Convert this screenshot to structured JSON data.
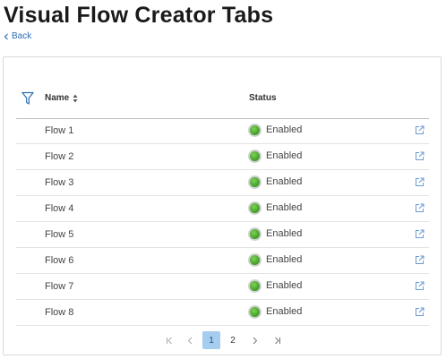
{
  "page": {
    "title": "Visual Flow Creator Tabs",
    "back_label": "Back"
  },
  "table": {
    "columns": {
      "name": "Name",
      "status": "Status"
    },
    "rows": [
      {
        "name": "Flow 1",
        "status": "Enabled"
      },
      {
        "name": "Flow 2",
        "status": "Enabled"
      },
      {
        "name": "Flow 3",
        "status": "Enabled"
      },
      {
        "name": "Flow 4",
        "status": "Enabled"
      },
      {
        "name": "Flow 5",
        "status": "Enabled"
      },
      {
        "name": "Flow 6",
        "status": "Enabled"
      },
      {
        "name": "Flow 7",
        "status": "Enabled"
      },
      {
        "name": "Flow 8",
        "status": "Enabled"
      }
    ],
    "status_color": "#4caf2f"
  },
  "pagination": {
    "pages": [
      "1",
      "2"
    ],
    "current_page": "1",
    "icons": [
      "first-page-icon",
      "prev-page-icon",
      "next-page-icon",
      "last-page-icon"
    ]
  },
  "colors": {
    "link": "#2d6db5",
    "active_page": "#a7cdee"
  }
}
